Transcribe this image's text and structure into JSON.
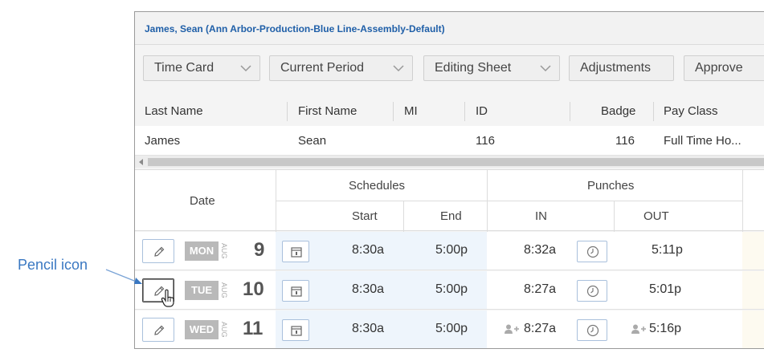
{
  "employee": {
    "title": "James, Sean (Ann Arbor-Production-Blue Line-Assembly-Default)"
  },
  "toolbar": {
    "buttons": [
      {
        "label": "Time Card",
        "has_dropdown": true
      },
      {
        "label": "Current Period",
        "has_dropdown": true
      },
      {
        "label": "Editing Sheet",
        "has_dropdown": true
      },
      {
        "label": "Adjustments",
        "has_dropdown": false
      },
      {
        "label": "Approve",
        "has_dropdown": false
      }
    ]
  },
  "employee_grid": {
    "columns": [
      "Last Name",
      "First Name",
      "MI",
      "ID",
      "Badge",
      "Pay Class"
    ],
    "row": {
      "last_name": "James",
      "first_name": "Sean",
      "mi": "",
      "id": "116",
      "badge": "116",
      "pay_class": "Full Time Ho..."
    }
  },
  "timecard": {
    "headers": {
      "date": "Date",
      "schedules": "Schedules",
      "punches": "Punches",
      "start": "Start",
      "end": "End",
      "in": "IN",
      "out": "OUT"
    },
    "rows": [
      {
        "dow": "MON",
        "month": "AUG",
        "day": "9",
        "start": "8:30a",
        "end": "5:00p",
        "in": "8:32a",
        "out": "5:11p",
        "in_person_icon": false,
        "out_person_icon": false
      },
      {
        "dow": "TUE",
        "month": "AUG",
        "day": "10",
        "start": "8:30a",
        "end": "5:00p",
        "in": "8:27a",
        "out": "5:01p",
        "in_person_icon": false,
        "out_person_icon": false
      },
      {
        "dow": "WED",
        "month": "AUG",
        "day": "11",
        "start": "8:30a",
        "end": "5:00p",
        "in": "8:27a",
        "out": "5:16p",
        "in_person_icon": true,
        "out_person_icon": true
      }
    ]
  },
  "callout": {
    "label": "Pencil icon"
  },
  "colors": {
    "title_blue": "#1f5fa8",
    "callout_blue": "#3a78c2",
    "schedule_bg": "#eef5fc",
    "day_badge": "#b9b9b9"
  },
  "icons": {
    "edit": "pencil-icon",
    "schedule": "calendar-icon",
    "punch": "clock-icon",
    "added_punch": "person-add-icon",
    "dropdown": "chevron-down-icon",
    "cursor": "hand-pointer-icon"
  }
}
